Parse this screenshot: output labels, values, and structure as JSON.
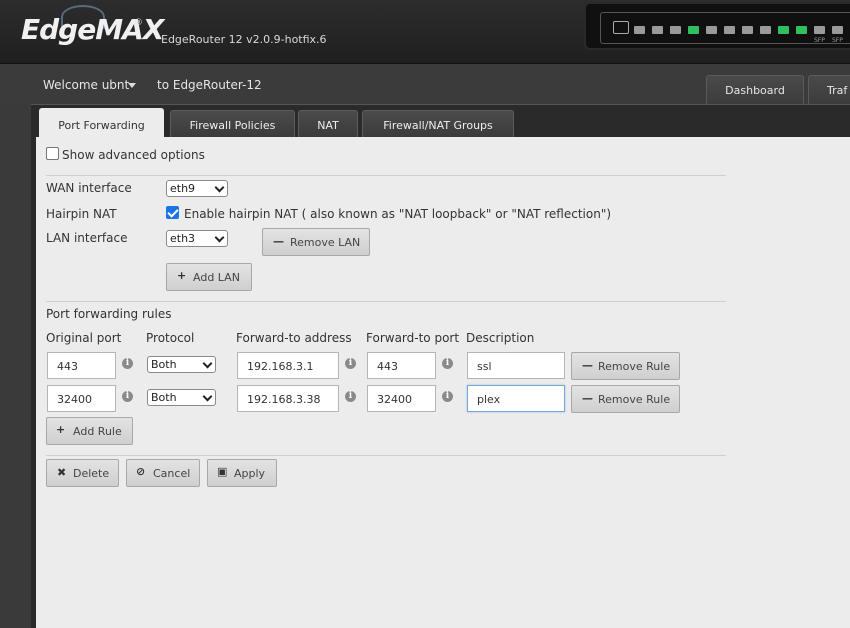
{
  "header": {
    "brand": "EdgeMAX",
    "trademark": "®",
    "version": "EdgeRouter 12 v2.0.9-hotfix.6",
    "port_labels": [
      "SFP",
      "SFP"
    ]
  },
  "subbar": {
    "welcome": "Welcome ubnt",
    "router": "to EdgeRouter-12",
    "tabs": [
      {
        "label": "Dashboard"
      },
      {
        "label": "Traf"
      }
    ]
  },
  "tabs": [
    {
      "label": "Port Forwarding",
      "active": true
    },
    {
      "label": "Firewall Policies",
      "active": false
    },
    {
      "label": "NAT",
      "active": false
    },
    {
      "label": "Firewall/NAT Groups",
      "active": false
    }
  ],
  "form": {
    "show_advanced": {
      "label": "Show advanced options",
      "checked": false
    },
    "wan_interface": {
      "label": "WAN interface",
      "value": "eth9"
    },
    "hairpin": {
      "label": "Hairpin NAT",
      "checked": true,
      "text": "Enable hairpin NAT ( also known as \"NAT loopback\" or \"NAT reflection\")"
    },
    "lan_interface": {
      "label": "LAN interface",
      "value": "eth3"
    },
    "remove_lan": "Remove LAN",
    "add_lan": "Add LAN",
    "rules_title": "Port forwarding rules",
    "columns": [
      "Original port",
      "Protocol",
      "Forward-to address",
      "Forward-to port",
      "Description"
    ],
    "rules": [
      {
        "original_port": "443",
        "protocol": "Both",
        "address": "192.168.3.1",
        "forward_port": "443",
        "description": "ssl",
        "remove": "Remove Rule"
      },
      {
        "original_port": "32400",
        "protocol": "Both",
        "address": "192.168.3.38",
        "forward_port": "32400",
        "description": "plex",
        "remove": "Remove Rule"
      }
    ],
    "add_rule": "Add Rule",
    "delete": "Delete",
    "cancel": "Cancel",
    "apply": "Apply"
  },
  "colors": {
    "header_bg": "#242424",
    "panel_bg": "#ececec",
    "checkbox_accent": "#1a73e8",
    "port_active": "#2fbf5c"
  }
}
